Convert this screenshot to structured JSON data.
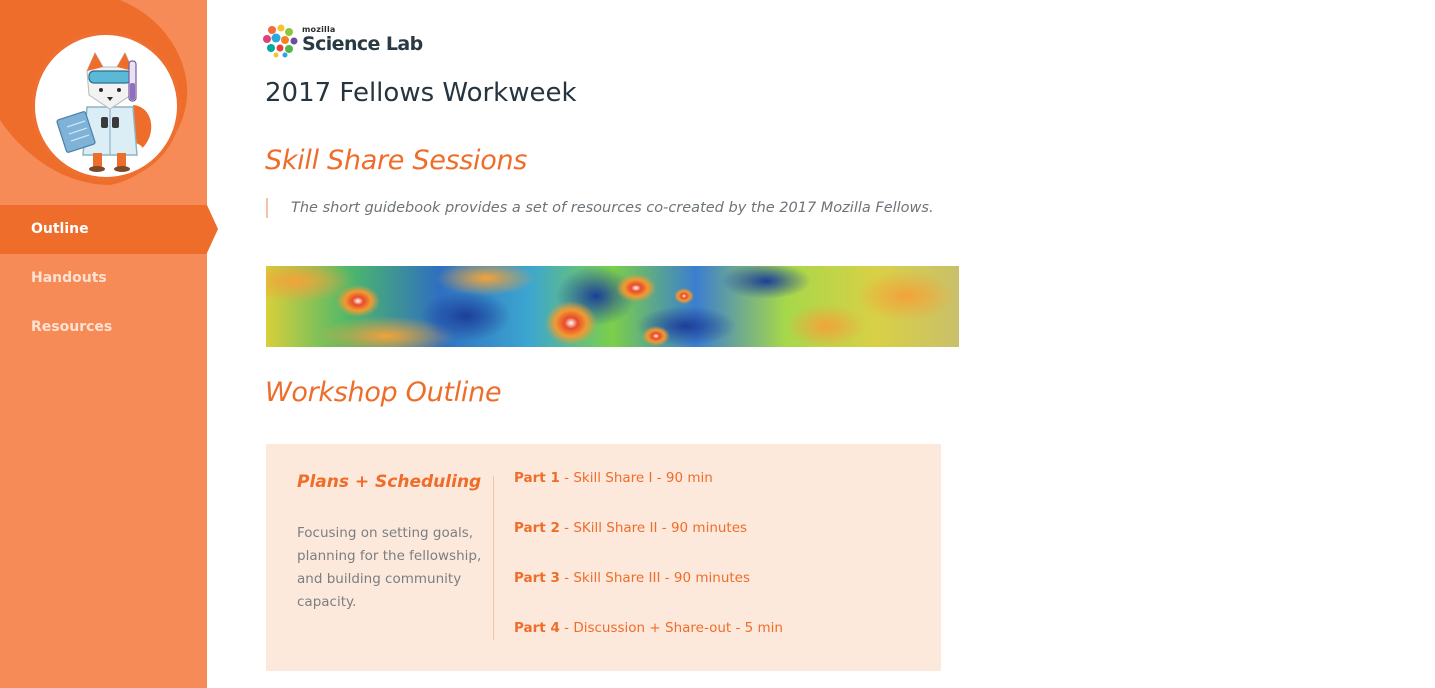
{
  "colors": {
    "accent": "#ef6d2a",
    "sidebar": "#f68b58",
    "card": "#fde8dc",
    "title": "#25353f"
  },
  "brand": {
    "small": "mozilla",
    "name": "Science Lab"
  },
  "sidebar": {
    "mascot": "fox-scientist-mascot",
    "items": [
      {
        "label": "Outline",
        "active": true
      },
      {
        "label": "Handouts",
        "active": false
      },
      {
        "label": "Resources",
        "active": false
      }
    ]
  },
  "page": {
    "title": "2017 Fellows Workweek",
    "section1": "Skill Share Sessions",
    "quote": "The short guidebook provides a set of resources co-created by the 2017 Mozilla Fellows.",
    "section2": "Workshop Outline"
  },
  "card": {
    "heading": "Plans + Scheduling",
    "description": "Focusing on setting goals, planning for the fellowship, and building community capacity.",
    "parts": [
      {
        "num": "Part 1",
        "text": " - Skill Share I - 90 min"
      },
      {
        "num": "Part 2",
        "text": " - SKill Share II - 90 minutes"
      },
      {
        "num": "Part 3",
        "text": " - Skill Share III - 90 minutes"
      },
      {
        "num": "Part 4",
        "text": " - Discussion + Share-out - 5 min"
      }
    ]
  }
}
